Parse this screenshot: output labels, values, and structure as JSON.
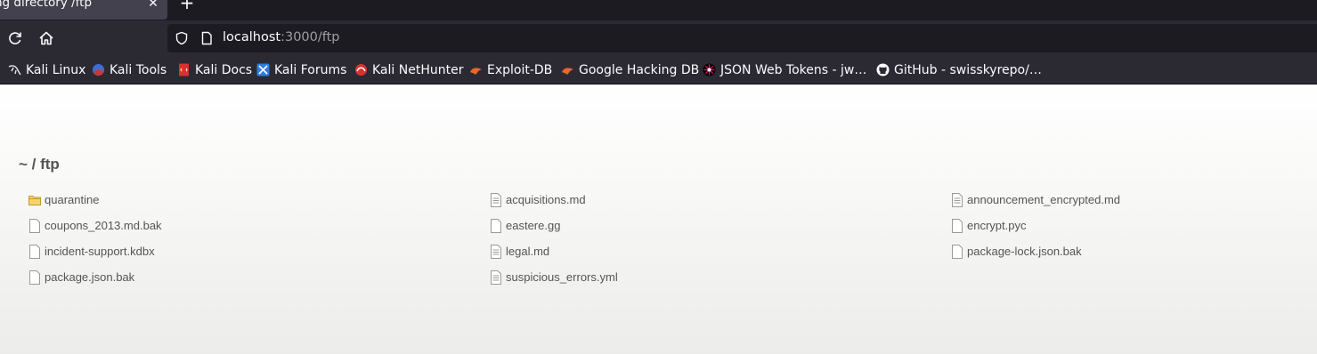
{
  "browser": {
    "tab_title": "ng directory /ftp",
    "close_glyph": "✕",
    "new_tab_glyph": "+",
    "url_host": "localhost",
    "url_rest": ":3000/ftp"
  },
  "bookmarks": [
    {
      "label": "Kali Linux",
      "icon": "kali-dragon-icon"
    },
    {
      "label": "Kali Tools",
      "icon": "kali-tools-icon"
    },
    {
      "label": "Kali Docs",
      "icon": "kali-docs-icon"
    },
    {
      "label": "Kali Forums",
      "icon": "kali-forums-icon"
    },
    {
      "label": "Kali NetHunter",
      "icon": "kali-nethunter-icon"
    },
    {
      "label": "Exploit-DB",
      "icon": "exploit-db-icon"
    },
    {
      "label": "Google Hacking DB",
      "icon": "ghdb-icon"
    },
    {
      "label": "JSON Web Tokens - jw…",
      "icon": "jwt-icon"
    },
    {
      "label": "GitHub - swisskyrepo/…",
      "icon": "github-icon"
    }
  ],
  "page": {
    "heading_tilde": "~",
    "heading_sep": " / ",
    "heading_dir": "ftp",
    "files": [
      {
        "name": "quarantine",
        "type": "folder"
      },
      {
        "name": "acquisitions.md",
        "type": "text"
      },
      {
        "name": "announcement_encrypted.md",
        "type": "text"
      },
      {
        "name": "coupons_2013.md.bak",
        "type": "file"
      },
      {
        "name": "eastere.gg",
        "type": "file"
      },
      {
        "name": "encrypt.pyc",
        "type": "file"
      },
      {
        "name": "incident-support.kdbx",
        "type": "file"
      },
      {
        "name": "legal.md",
        "type": "text"
      },
      {
        "name": "package-lock.json.bak",
        "type": "file"
      },
      {
        "name": "package.json.bak",
        "type": "file"
      },
      {
        "name": "suspicious_errors.yml",
        "type": "text"
      }
    ]
  }
}
